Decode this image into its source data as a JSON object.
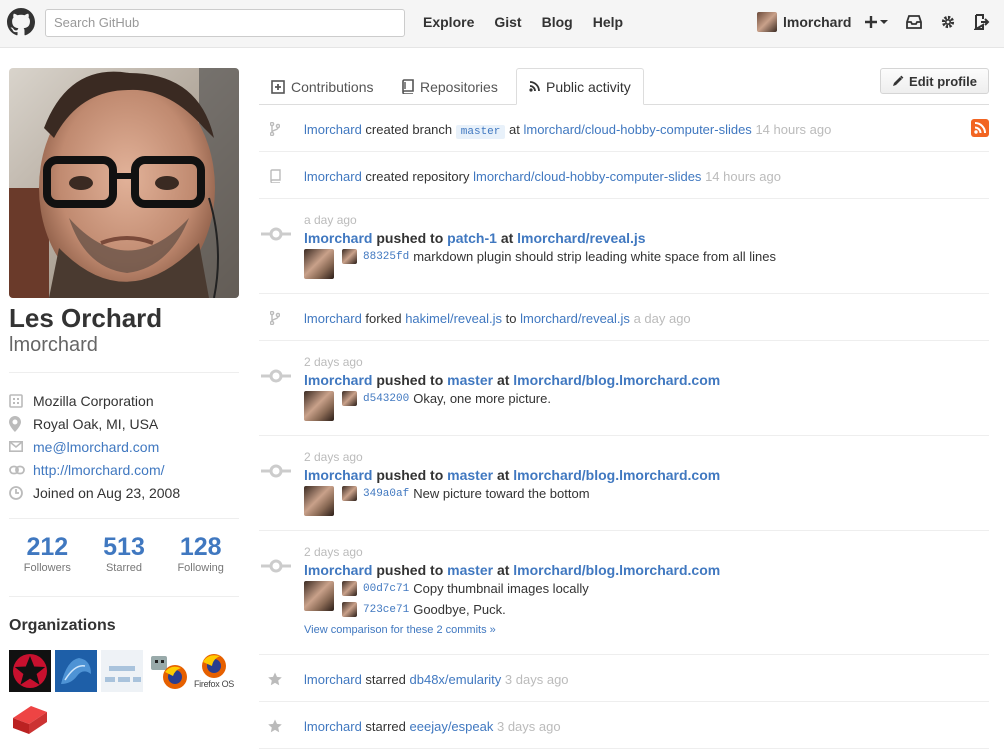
{
  "header": {
    "search_placeholder": "Search GitHub",
    "nav": [
      "Explore",
      "Gist",
      "Blog",
      "Help"
    ],
    "username": "lmorchard"
  },
  "profile": {
    "fullname": "Les Orchard",
    "username": "lmorchard",
    "details": {
      "company": "Mozilla Corporation",
      "location": "Royal Oak, MI, USA",
      "email": "me@lmorchard.com",
      "url": "http://lmorchard.com/",
      "joined": "Joined on Aug 23, 2008"
    },
    "stats": [
      {
        "num": "212",
        "label": "Followers"
      },
      {
        "num": "513",
        "label": "Starred"
      },
      {
        "num": "128",
        "label": "Following"
      }
    ],
    "orgs_title": "Organizations",
    "firefox_os_label": "Firefox OS"
  },
  "tabs": [
    "Contributions",
    "Repositories",
    "Public activity"
  ],
  "edit_profile": "Edit profile",
  "feed": {
    "i1": {
      "user": "lmorchard",
      "action": "created branch",
      "branch": "master",
      "at": "at",
      "repo": "lmorchard/cloud-hobby-computer-slides",
      "time": "14 hours ago"
    },
    "i2": {
      "user": "lmorchard",
      "action": "created repository",
      "repo": "lmorchard/cloud-hobby-computer-slides",
      "time": "14 hours ago"
    },
    "i3": {
      "ago": "a day ago",
      "user": "lmorchard",
      "pushed": "pushed to",
      "branch": "patch-1",
      "at": "at",
      "repo": "lmorchard/reveal.js",
      "commits": [
        {
          "sha": "88325fd",
          "msg": "markdown plugin should strip leading white space from all lines"
        }
      ]
    },
    "i4": {
      "user": "lmorchard",
      "action": "forked",
      "src": "hakimel/reveal.js",
      "to": "to",
      "repo": "lmorchard/reveal.js",
      "time": "a day ago"
    },
    "i5": {
      "ago": "2 days ago",
      "user": "lmorchard",
      "pushed": "pushed to",
      "branch": "master",
      "at": "at",
      "repo": "lmorchard/blog.lmorchard.com",
      "commits": [
        {
          "sha": "d543200",
          "msg": "Okay, one more picture."
        }
      ]
    },
    "i6": {
      "ago": "2 days ago",
      "user": "lmorchard",
      "pushed": "pushed to",
      "branch": "master",
      "at": "at",
      "repo": "lmorchard/blog.lmorchard.com",
      "commits": [
        {
          "sha": "349a0af",
          "msg": "New picture toward the bottom"
        }
      ]
    },
    "i7": {
      "ago": "2 days ago",
      "user": "lmorchard",
      "pushed": "pushed to",
      "branch": "master",
      "at": "at",
      "repo": "lmorchard/blog.lmorchard.com",
      "commits": [
        {
          "sha": "00d7c71",
          "msg": "Copy thumbnail images locally"
        },
        {
          "sha": "723ce71",
          "msg": "Goodbye, Puck."
        }
      ],
      "compare": "View comparison for these 2 commits »"
    },
    "i8": {
      "user": "lmorchard",
      "action": "starred",
      "repo": "db48x/emularity",
      "time": "3 days ago"
    },
    "i9": {
      "user": "lmorchard",
      "action": "starred",
      "repo": "eeejay/espeak",
      "time": "3 days ago"
    }
  }
}
